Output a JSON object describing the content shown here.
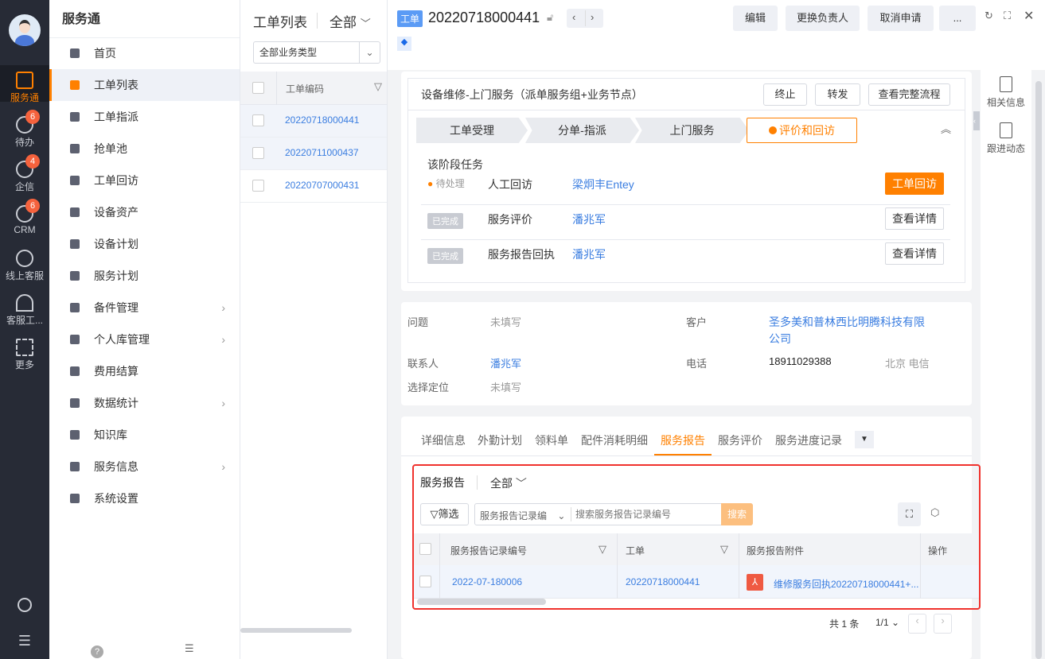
{
  "rail": {
    "items": [
      {
        "label": "服务通"
      },
      {
        "label": "待办",
        "badge": "6"
      },
      {
        "label": "企信",
        "badge": "4"
      },
      {
        "label": "CRM",
        "badge": "6"
      },
      {
        "label": "线上客服"
      },
      {
        "label": "客服工..."
      },
      {
        "label": "更多"
      }
    ]
  },
  "menu": {
    "title": "服务通",
    "items": [
      {
        "label": "首页"
      },
      {
        "label": "工单列表"
      },
      {
        "label": "工单指派"
      },
      {
        "label": "抢单池"
      },
      {
        "label": "工单回访"
      },
      {
        "label": "设备资产"
      },
      {
        "label": "设备计划"
      },
      {
        "label": "服务计划"
      },
      {
        "label": "备件管理"
      },
      {
        "label": "个人库管理"
      },
      {
        "label": "费用结算"
      },
      {
        "label": "数据统计"
      },
      {
        "label": "知识库"
      },
      {
        "label": "服务信息"
      },
      {
        "label": "系统设置"
      }
    ]
  },
  "list": {
    "title": "工单列表",
    "scope": "全部",
    "type_select": "全部业务类型",
    "column": "工单编码",
    "rows": [
      "20220718000441",
      "20220711000437",
      "20220707000431"
    ]
  },
  "detail": {
    "tag": "工单",
    "id": "20220718000441",
    "buttons": {
      "edit": "编辑",
      "change_owner": "更换负责人",
      "cancel": "取消申请",
      "more": "..."
    },
    "flow": {
      "title": "设备维修-上门服务（派单服务组+业务节点）",
      "terminate": "终止",
      "forward": "转发",
      "view_flow": "查看完整流程",
      "steps": [
        "工单受理",
        "分单-指派",
        "上门服务",
        "评价和回访"
      ],
      "stage_tasks_title": "该阶段任务",
      "tasks": [
        {
          "status": "待处理",
          "name": "人工回访",
          "person": "梁炯丰Entey",
          "action": "工单回访"
        },
        {
          "status": "已完成",
          "name": "服务评价",
          "person": "潘兆军",
          "action": "查看详情"
        },
        {
          "status": "已完成",
          "name": "服务报告回执",
          "person": "潘兆军",
          "action": "查看详情"
        }
      ]
    },
    "info": {
      "problem_label": "问题",
      "problem": "未填写",
      "customer_label": "客户",
      "customer": "圣多美和普林西比明腾科技有限公司",
      "contact_label": "联系人",
      "contact": "潘兆军",
      "phone_label": "电话",
      "phone": "18911029388",
      "phone_region": "北京 电信",
      "location_label": "选择定位",
      "location": "未填写"
    },
    "tabs": [
      "详细信息",
      "外勤计划",
      "领料单",
      "配件消耗明细",
      "服务报告",
      "服务评价",
      "服务进度记录"
    ],
    "report": {
      "title": "服务报告",
      "scope": "全部",
      "filter": "筛选",
      "field_select": "服务报告记录编",
      "search_placeholder": "搜索服务报告记录编号",
      "search": "搜索",
      "columns": [
        "服务报告记录编号",
        "工单",
        "服务报告附件",
        "操作"
      ],
      "rows": [
        {
          "code": "2022-07-180006",
          "order": "20220718000441",
          "attachment": "维修服务回执20220718000441+..."
        }
      ],
      "total": "共 1 条",
      "page": "1/1"
    }
  },
  "side": {
    "related": "相关信息",
    "follow": "跟进动态"
  }
}
